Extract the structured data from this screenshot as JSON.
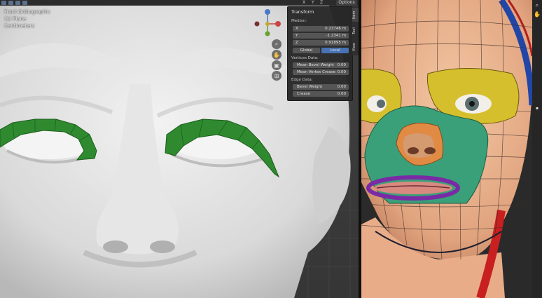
{
  "left_viewport": {
    "overlay_lines": [
      "Front Orthographic",
      "(1) Plane",
      "Centimeters"
    ],
    "header": {
      "axis_x": "X",
      "axis_y": "Y",
      "axis_z": "Z",
      "options_label": "Options"
    },
    "gizmo": {
      "x": "X",
      "y": "Y",
      "z": "Z"
    }
  },
  "npanel": {
    "title": "Transform",
    "median_label": "Median:",
    "fields": [
      {
        "key": "X",
        "value": "0.23746 m"
      },
      {
        "key": "Y",
        "value": "-1.2341 m"
      },
      {
        "key": "Z",
        "value": "0.91895 m"
      }
    ],
    "space_global": "Global",
    "space_local": "Local",
    "vertices_label": "Vertices Data:",
    "vertex_fields": [
      {
        "key": "Mean Bevel Weight",
        "value": "0.00"
      },
      {
        "key": "Mean Vertex Crease",
        "value": "0.00"
      }
    ],
    "edge_label": "Edge Data:",
    "edge_fields": [
      {
        "key": "Bevel Weight",
        "value": "0.00"
      },
      {
        "key": "Crease",
        "value": "0.00"
      }
    ],
    "tabs": [
      "Item",
      "Tool",
      "View"
    ]
  },
  "colors": {
    "accent": "#4772b3",
    "eye_loop": "#2e8b2e",
    "mouth_loop": "#7a2aa5",
    "nose_loop": "#c86a18",
    "eye_region": "#c8b22a",
    "mask_region": "#3aa079",
    "outline_band": "#2146a8",
    "neck_band": "#c82020"
  }
}
